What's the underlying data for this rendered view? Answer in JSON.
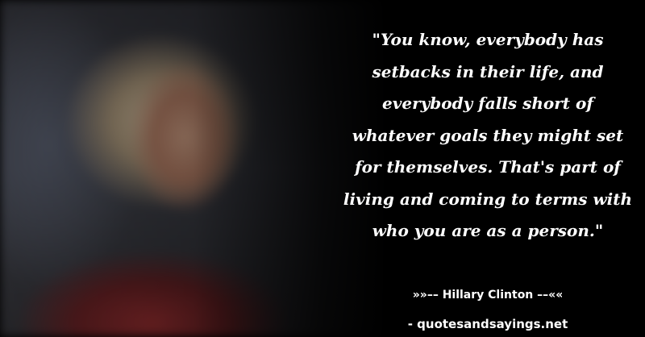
{
  "quote": "\"You know, everybody has\nsetbacks in their life, and\neverybody falls short of\nwhatever goals they might set\nfor themselves. That's part of\nliving and coming to terms with\nwho you are as a person.\"",
  "author": "»»–– Hillary Clinton ––««",
  "site": "- quotesandsayings.net"
}
